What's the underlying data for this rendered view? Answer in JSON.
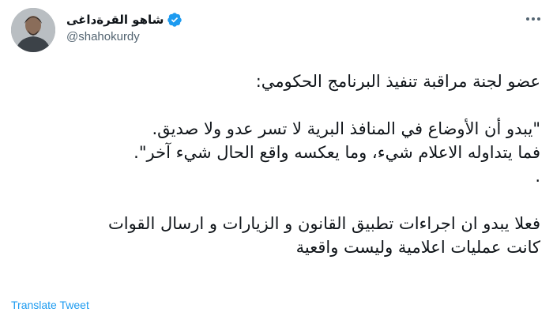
{
  "user": {
    "display_name": "شاهو القرةداغى",
    "handle": "@shahokurdy",
    "verified": true
  },
  "icons": {
    "verified": "verified-badge-icon",
    "more": "more-options-icon"
  },
  "colors": {
    "verified_blue": "#1d9bf0",
    "link_blue": "#1d9bf0",
    "secondary_text": "#536471"
  },
  "tweet": {
    "lines": [
      "عضو لجنة مراقبة تنفيذ البرنامج الحكومي:",
      "",
      "\"يبدو أن الأوضاع في المنافذ البرية لا تسر عدو ولا صديق.",
      "فما يتداوله الاعلام شيء، وما يعكسه واقع الحال شيء آخر\".",
      ".",
      "",
      "فعلا يبدو ان اجراءات تطبيق القانون و الزيارات و ارسال القوات",
      "كانت عمليات اعلامية وليست واقعية"
    ]
  },
  "actions": {
    "translate_label": "Translate Tweet"
  }
}
